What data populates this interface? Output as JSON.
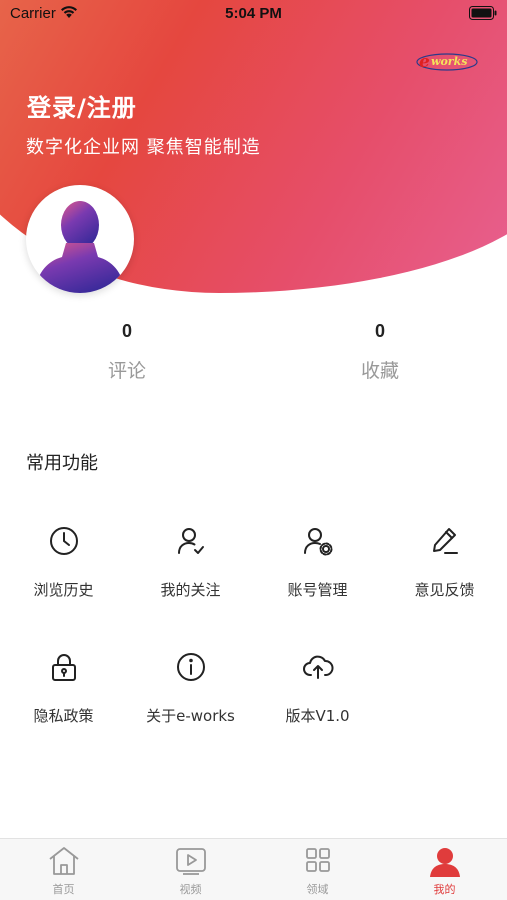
{
  "status_bar": {
    "carrier": "Carrier",
    "time": "5:04 PM"
  },
  "header": {
    "logo_text": "e-works",
    "login_label": "登录/注册",
    "slogan": "数字化企业网 聚焦智能制造"
  },
  "stats": [
    {
      "value": "0",
      "label": "评论"
    },
    {
      "value": "0",
      "label": "收藏"
    }
  ],
  "section_title": "常用功能",
  "features": [
    {
      "label": "浏览历史",
      "icon": "clock-icon"
    },
    {
      "label": "我的关注",
      "icon": "user-check-icon"
    },
    {
      "label": "账号管理",
      "icon": "user-settings-icon"
    },
    {
      "label": "意见反馈",
      "icon": "pen-icon"
    },
    {
      "label": "隐私政策",
      "icon": "lock-icon"
    },
    {
      "label": "关于e-works",
      "icon": "info-icon"
    },
    {
      "label": "版本V1.0",
      "icon": "cloud-upload-icon"
    }
  ],
  "tabs": [
    {
      "label": "首页",
      "icon": "home-icon",
      "active": false
    },
    {
      "label": "视频",
      "icon": "video-icon",
      "active": false
    },
    {
      "label": "领域",
      "icon": "grid-icon",
      "active": false
    },
    {
      "label": "我的",
      "icon": "profile-icon",
      "active": true
    }
  ],
  "colors": {
    "accent": "#e03c3c",
    "gradient_start": "#e8704e",
    "gradient_mid": "#e5473f",
    "gradient_end": "#e86498",
    "muted_text": "#999999"
  }
}
